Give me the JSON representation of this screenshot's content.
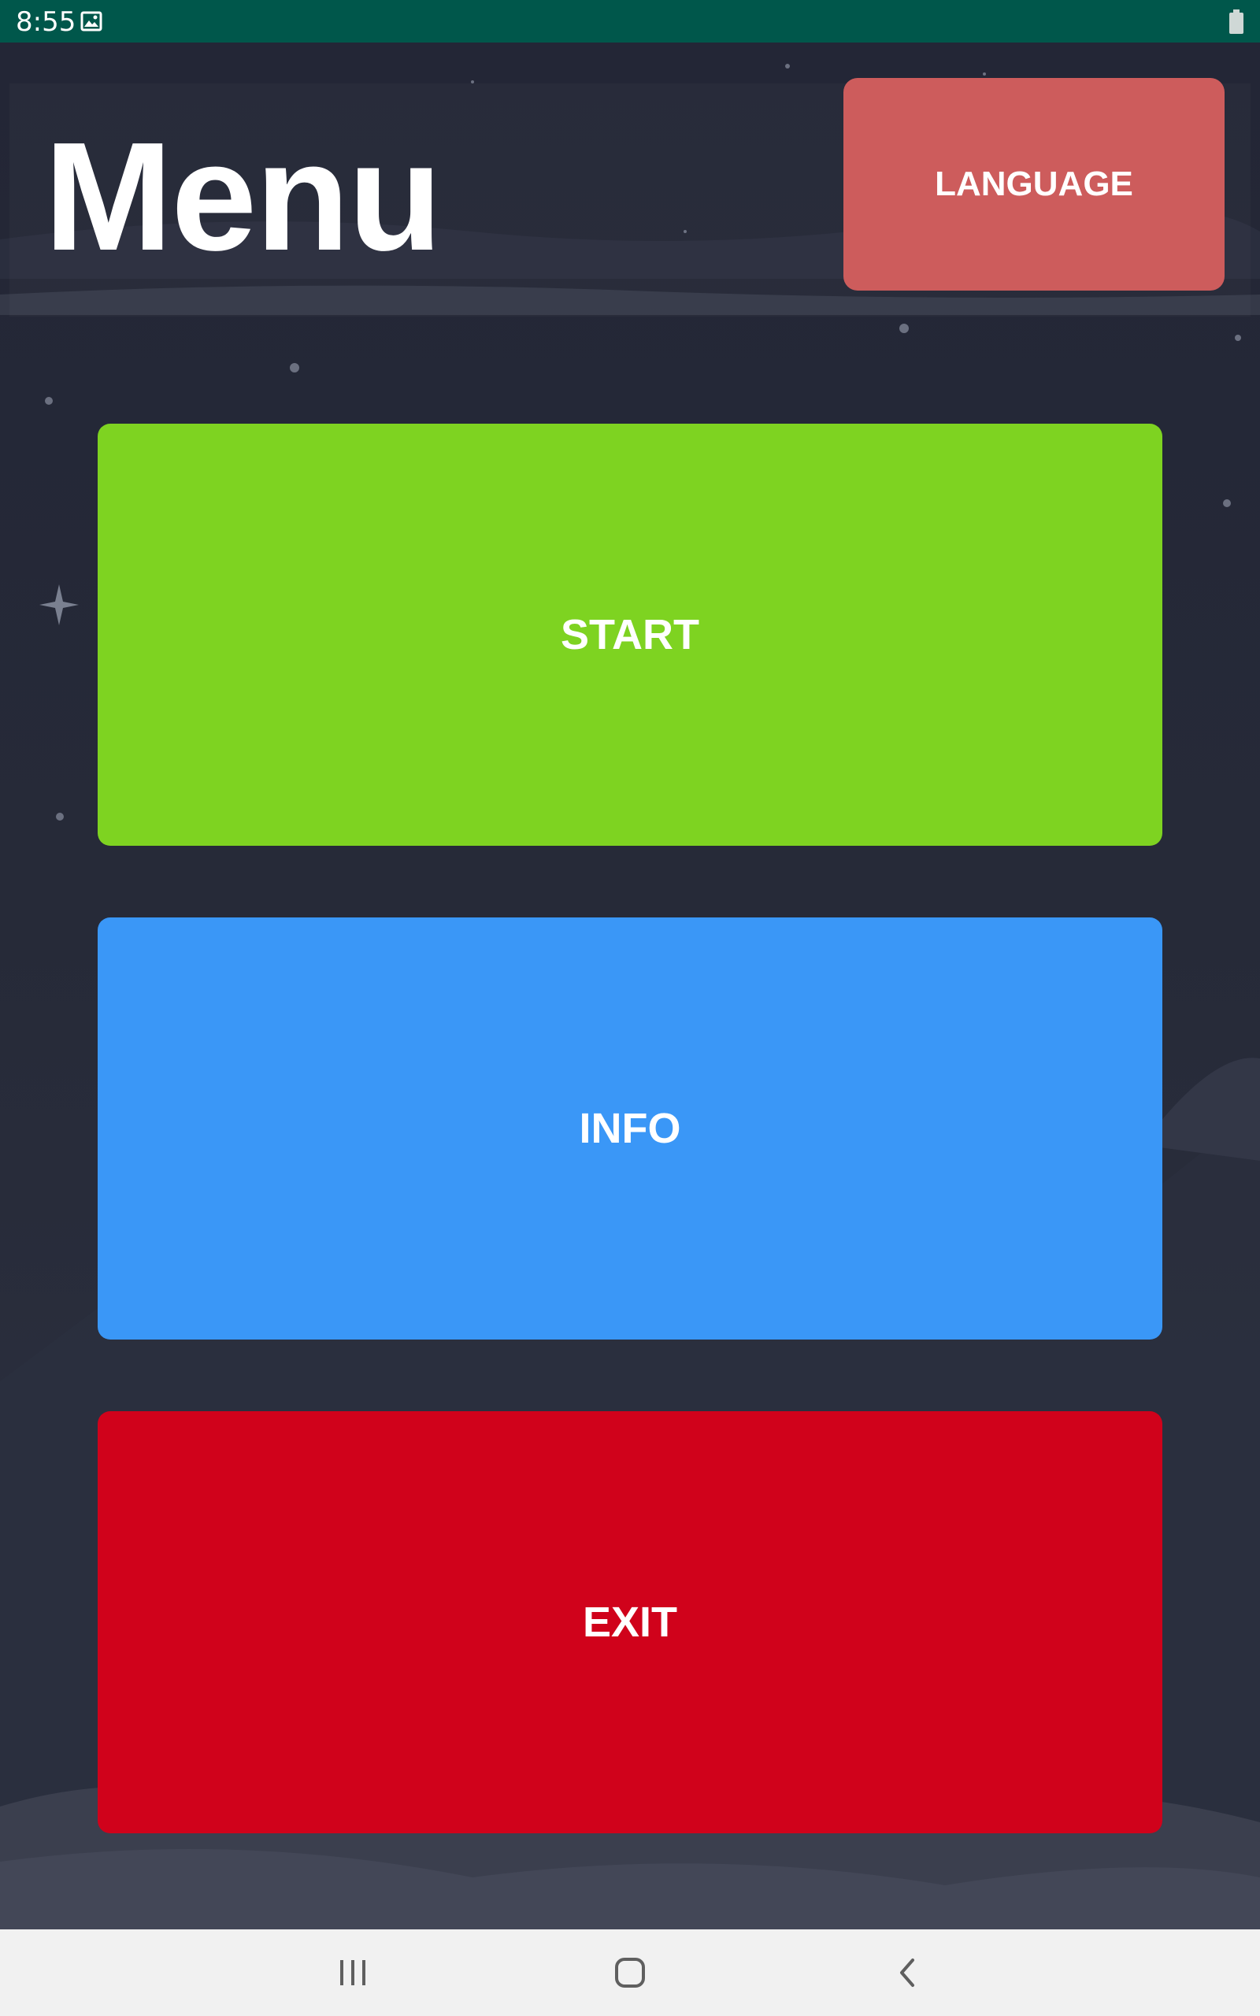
{
  "status_bar": {
    "time": "8:55",
    "icons": [
      "gallery-icon",
      "battery-icon"
    ]
  },
  "header": {
    "title": "Menu",
    "language_button": "LANGUAGE"
  },
  "menu": {
    "start_label": "START",
    "info_label": "INFO",
    "exit_label": "EXIT"
  },
  "nav_bar": {
    "icons": [
      "recents-icon",
      "home-icon",
      "back-icon"
    ]
  },
  "colors": {
    "status_bar": "#00574b",
    "background": "#242735",
    "language_button": "#cd5c5c",
    "start_button": "#7ed321",
    "info_button": "#3a97f7",
    "exit_button": "#d0021b",
    "nav_bar": "#f1f1f1"
  }
}
